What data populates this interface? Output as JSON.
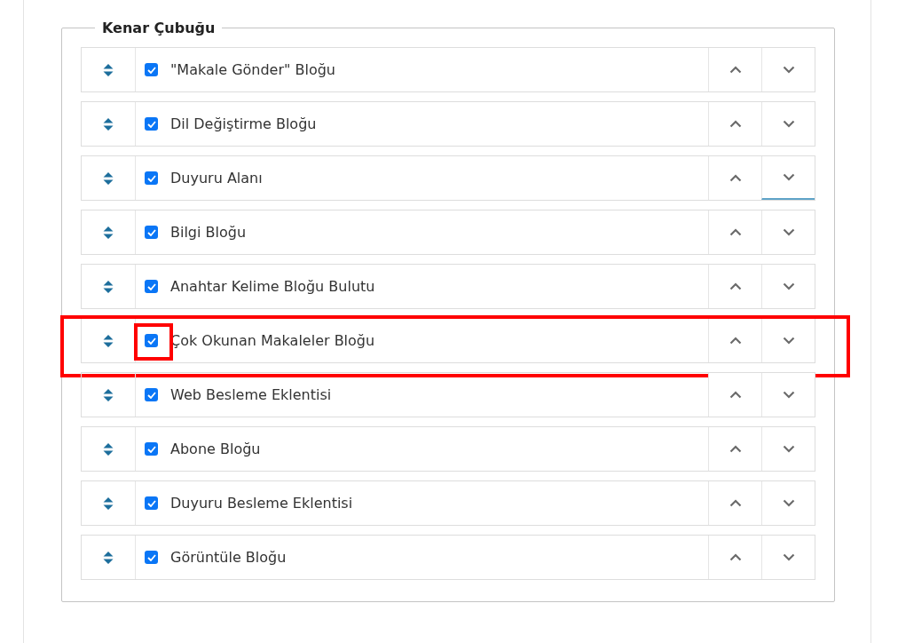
{
  "fieldset": {
    "legend": "Kenar Çubuğu"
  },
  "rows": [
    {
      "label": "\"Makale Gönder\" Bloğu",
      "checked": true,
      "highlighted": false,
      "checkbox_highlighted": false,
      "down_focused": false
    },
    {
      "label": "Dil Değiştirme Bloğu",
      "checked": true,
      "highlighted": false,
      "checkbox_highlighted": false,
      "down_focused": false
    },
    {
      "label": "Duyuru Alanı",
      "checked": true,
      "highlighted": false,
      "checkbox_highlighted": false,
      "down_focused": true
    },
    {
      "label": "Bilgi Bloğu",
      "checked": true,
      "highlighted": false,
      "checkbox_highlighted": false,
      "down_focused": false
    },
    {
      "label": "Anahtar Kelime Bloğu Bulutu",
      "checked": true,
      "highlighted": false,
      "checkbox_highlighted": false,
      "down_focused": false
    },
    {
      "label": "Çok Okunan Makaleler Bloğu",
      "checked": true,
      "highlighted": true,
      "checkbox_highlighted": true,
      "down_focused": false
    },
    {
      "label": "Web Besleme Eklentisi",
      "checked": true,
      "highlighted": false,
      "checkbox_highlighted": false,
      "down_focused": false
    },
    {
      "label": "Abone Bloğu",
      "checked": true,
      "highlighted": false,
      "checkbox_highlighted": false,
      "down_focused": false
    },
    {
      "label": "Duyuru Besleme Eklentisi",
      "checked": true,
      "highlighted": false,
      "checkbox_highlighted": false,
      "down_focused": false
    },
    {
      "label": "Görüntüle Bloğu",
      "checked": true,
      "highlighted": false,
      "checkbox_highlighted": false,
      "down_focused": false
    }
  ]
}
